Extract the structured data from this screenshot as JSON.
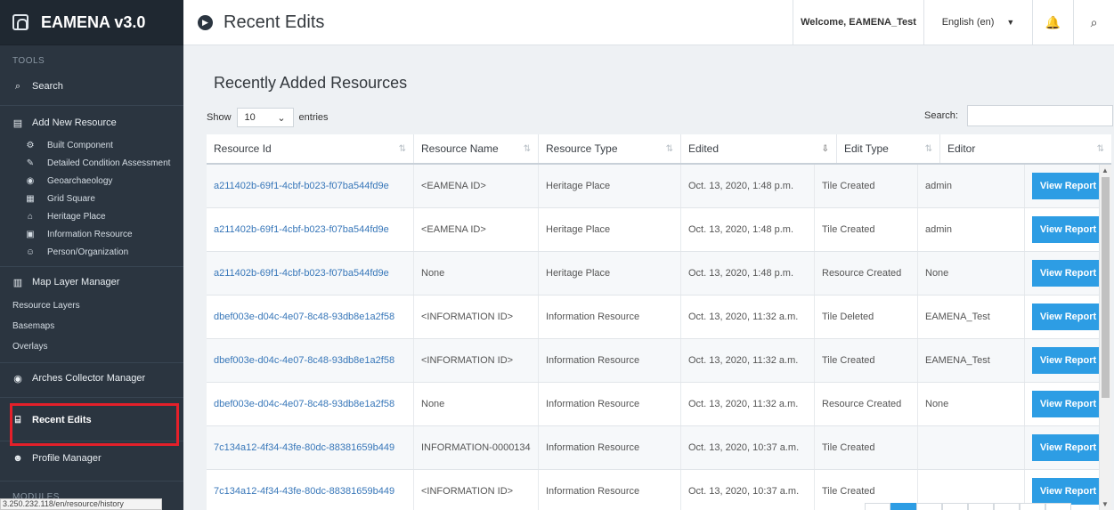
{
  "sidebar": {
    "brand": "EAMENA v3.0",
    "tools_label": "TOOLS",
    "search": "Search",
    "add_new_resource": "Add New Resource",
    "resource_types": [
      {
        "label": "Built Component",
        "icon": "cogs-icon"
      },
      {
        "label": "Detailed Condition Assessment",
        "icon": "edit-icon"
      },
      {
        "label": "Geoarchaeology",
        "icon": "globe-icon"
      },
      {
        "label": "Grid Square",
        "icon": "grid-icon"
      },
      {
        "label": "Heritage Place",
        "icon": "institution-icon"
      },
      {
        "label": "Information Resource",
        "icon": "file-image-icon"
      },
      {
        "label": "Person/Organization",
        "icon": "users-icon"
      }
    ],
    "map_layer_manager": "Map Layer Manager",
    "map_layers": [
      "Resource Layers",
      "Basemaps",
      "Overlays"
    ],
    "arches_collector_manager": "Arches Collector Manager",
    "recent_edits": "Recent Edits",
    "profile_manager": "Profile Manager",
    "modules_label": "MODULES",
    "status_url": "3.250.232.118/en/resource/history"
  },
  "topbar": {
    "title": "Recent Edits",
    "welcome": "Welcome, EAMENA_Test",
    "language": "English (en)"
  },
  "main": {
    "section_title": "Recently Added Resources",
    "show_label": "Show",
    "entries_value": "10",
    "entries_label": "entries",
    "search_label": "Search:",
    "search_value": "",
    "columns": [
      "Resource Id",
      "Resource Name",
      "Resource Type",
      "Edited",
      "Edit Type",
      "Editor",
      ""
    ],
    "rows": [
      {
        "id": "a211402b-69f1-4cbf-b023-f07ba544fd9e",
        "name": "<EAMENA ID>",
        "type": "Heritage Place",
        "edited": "Oct. 13, 2020, 1:48 p.m.",
        "edit_type": "Tile Created",
        "editor": "admin",
        "action": "View Report"
      },
      {
        "id": "a211402b-69f1-4cbf-b023-f07ba544fd9e",
        "name": "<EAMENA ID>",
        "type": "Heritage Place",
        "edited": "Oct. 13, 2020, 1:48 p.m.",
        "edit_type": "Tile Created",
        "editor": "admin",
        "action": "View Report"
      },
      {
        "id": "a211402b-69f1-4cbf-b023-f07ba544fd9e",
        "name": "None",
        "type": "Heritage Place",
        "edited": "Oct. 13, 2020, 1:48 p.m.",
        "edit_type": "Resource Created",
        "editor": "None",
        "action": "View Report"
      },
      {
        "id": "dbef003e-d04c-4e07-8c48-93db8e1a2f58",
        "name": "<INFORMATION ID>",
        "type": "Information Resource",
        "edited": "Oct. 13, 2020, 11:32 a.m.",
        "edit_type": "Tile Deleted",
        "editor": "EAMENA_Test",
        "action": "View Report"
      },
      {
        "id": "dbef003e-d04c-4e07-8c48-93db8e1a2f58",
        "name": "<INFORMATION ID>",
        "type": "Information Resource",
        "edited": "Oct. 13, 2020, 11:32 a.m.",
        "edit_type": "Tile Created",
        "editor": "EAMENA_Test",
        "action": "View Report"
      },
      {
        "id": "dbef003e-d04c-4e07-8c48-93db8e1a2f58",
        "name": "None",
        "type": "Information Resource",
        "edited": "Oct. 13, 2020, 11:32 a.m.",
        "edit_type": "Resource Created",
        "editor": "None",
        "action": "View Report"
      },
      {
        "id": "7c134a12-4f34-43fe-80dc-88381659b449",
        "name": "INFORMATION-0000134",
        "type": "Information Resource",
        "edited": "Oct. 13, 2020, 10:37 a.m.",
        "edit_type": "Tile Created",
        "editor": "",
        "action": "View Report"
      },
      {
        "id": "7c134a12-4f34-43fe-80dc-88381659b449",
        "name": "<INFORMATION ID>",
        "type": "Information Resource",
        "edited": "Oct. 13, 2020, 10:37 a.m.",
        "edit_type": "Tile Created",
        "editor": "",
        "action": "View Report"
      }
    ]
  },
  "colors": {
    "sidebar_bg": "#2b3540",
    "accent": "#2d9de4",
    "link": "#3877b9",
    "highlight_box": "#e4202a"
  }
}
